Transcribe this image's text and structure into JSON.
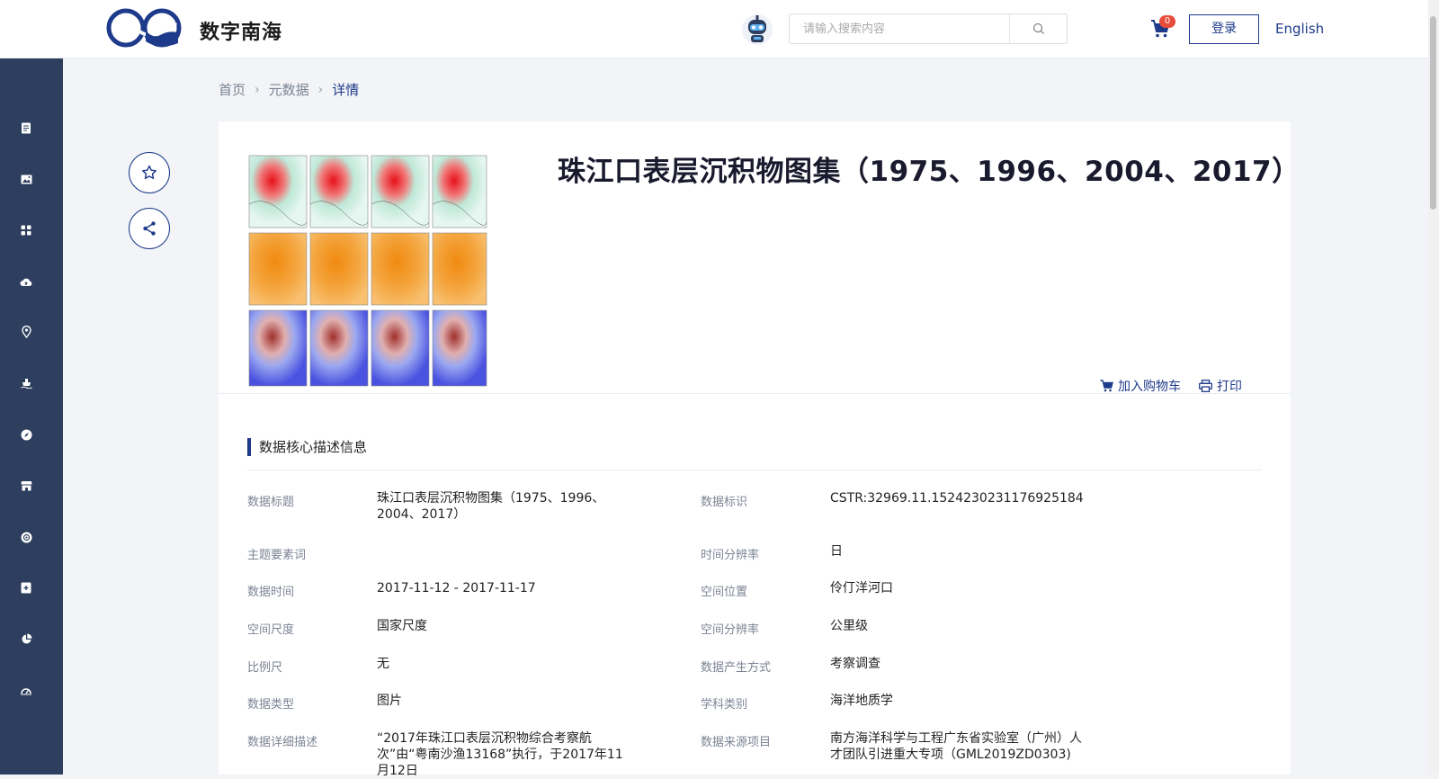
{
  "header": {
    "site_name": "数字南海",
    "search_placeholder": "请输入搜索内容",
    "cart_count": "0",
    "login_label": "登录",
    "lang_label": "English"
  },
  "sidebar": {
    "icons": [
      "document-icon",
      "image-icon",
      "grid-icon",
      "cloud-upload-icon",
      "location-pin-icon",
      "ship-icon",
      "compass-icon",
      "store-icon",
      "globe-icon",
      "add-box-icon",
      "pie-chart-icon",
      "dashboard-icon"
    ]
  },
  "breadcrumb": {
    "home": "首页",
    "metadata": "元数据",
    "current": "详情"
  },
  "dataset": {
    "title": "珠江口表层沉积物图集（1975、1996、2004、2017）",
    "add_to_cart": "加入购物车",
    "print": "打印"
  },
  "section": {
    "title": "数据核心描述信息"
  },
  "fields": {
    "left": [
      {
        "label": "数据标题",
        "value": "珠江口表层沉积物图集（1975、1996、2004、2017）"
      },
      {
        "label": "主题要素词",
        "value": ""
      },
      {
        "label": "数据时间",
        "value": "2017-11-12 - 2017-11-17"
      },
      {
        "label": "空间尺度",
        "value": "国家尺度"
      },
      {
        "label": "比例尺",
        "value": "无"
      },
      {
        "label": "数据类型",
        "value": "图片"
      },
      {
        "label": "数据详细描述",
        "value": "“2017年珠江口表层沉积物综合考察航次”由“粤南沙渔13168”执行，于2017年11月12日"
      }
    ],
    "right": [
      {
        "label": "数据标识",
        "value": "CSTR:32969.11.1524230231176925184"
      },
      {
        "label": "时间分辨率",
        "value": "日"
      },
      {
        "label": "空间位置",
        "value": "伶仃洋河口"
      },
      {
        "label": "空间分辨率",
        "value": "公里级"
      },
      {
        "label": "数据产生方式",
        "value": "考察调查"
      },
      {
        "label": "学科类别",
        "value": "海洋地质学"
      },
      {
        "label": "数据来源项目",
        "value": "南方海洋科学与工程广东省实验室（广州）人才团队引进重大专项（GML2019ZD0303)"
      }
    ]
  },
  "colors": {
    "brand": "#1e3a8a",
    "sidebar": "#2d3e5e",
    "badge": "#e74c3c"
  }
}
